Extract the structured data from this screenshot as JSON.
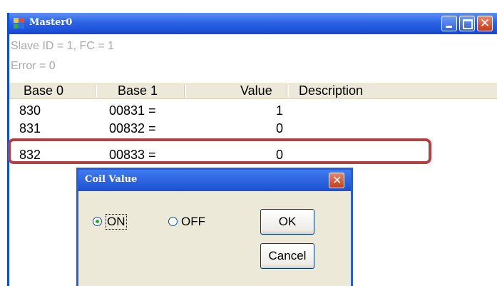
{
  "window": {
    "title": "Master0",
    "status_line1": "Slave ID = 1, FC = 1",
    "status_line2": "Error = 0"
  },
  "table": {
    "columns": [
      "Base 0",
      "Base 1",
      "Value",
      "Description"
    ],
    "rows": [
      {
        "base0": "830",
        "base1": "00831  =",
        "value": "1"
      },
      {
        "base0": "831",
        "base1": "00832  =",
        "value": "0"
      },
      {
        "base0": "832",
        "base1": "00833  =",
        "value": "0"
      }
    ]
  },
  "dialog": {
    "title": "Coil Value",
    "option_on": "ON",
    "option_off": "OFF",
    "selected": "ON",
    "ok_label": "OK",
    "cancel_label": "Cancel"
  },
  "colors": {
    "highlight_border": "#b23f42",
    "titlebar": "#2b64e6"
  },
  "icons": [
    "app-icon",
    "minimize-icon",
    "maximize-icon",
    "close-icon",
    "dialog-close-icon"
  ]
}
